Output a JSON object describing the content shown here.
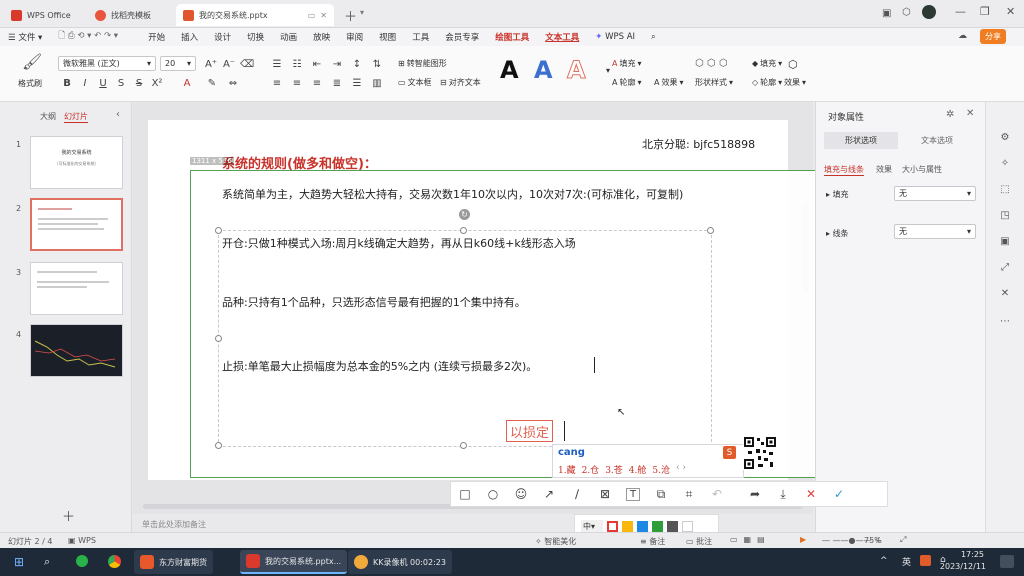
{
  "tabs": {
    "t1": "WPS Office",
    "t2": "找稻壳模板",
    "t3": "我的交易系统.pptx"
  },
  "menu": {
    "file": "文件",
    "items": [
      "开始",
      "插入",
      "设计",
      "切换",
      "动画",
      "放映",
      "审阅",
      "视图",
      "工具",
      "会员专享"
    ],
    "drawing_tools": "绘图工具",
    "text_tools": "文本工具",
    "wps_ai": "WPS AI",
    "share": "分享"
  },
  "ribbon": {
    "format_painter": "格式刷",
    "font_name": "微软雅黑 (正文)",
    "font_size": "20",
    "convert_shape": "转智能图形",
    "text_box": "文本框",
    "align_text": "对齐文本",
    "fill": "填充",
    "outline": "轮廓",
    "effect": "效果",
    "shape_style": "形状样式",
    "big_a": "A"
  },
  "left_pane": {
    "tab_outline": "大纲",
    "tab_slides": "幻灯片",
    "thumb1_title": "我的交易系统",
    "thumb1_sub": "（可标准化的交易系统）"
  },
  "slide": {
    "size_label": "1311 x 576",
    "contact": "北京分聪: bjfc518898",
    "heading": "系统的规则(做多和做空)：",
    "line1": "系统简单为主，大趋势大轻松大持有，交易次数1年10次以内，10次对7次:(可标准化，可复制)",
    "line2": "开仓:只做1种模式入场:周月k线确定大趋势，再从日k60线+k线形态入场",
    "line3": "品种:只持有1个品种，只选形态信号最有把握的1个集中持有。",
    "line4": "止损:单笔最大止损幅度为总本金的5%之内 (连续亏损最多2次)。",
    "typed_text": "以损定"
  },
  "ime": {
    "pinyin": "cang",
    "candidates": [
      "1.藏",
      "2.仓",
      "3.苍",
      "4.舱",
      "5.沧"
    ]
  },
  "right_pane": {
    "title": "对象属性",
    "tab1": "形状选项",
    "tab2": "文本选项",
    "sub1": "填充与线条",
    "sub2": "效果",
    "sub3": "大小与属性",
    "fill_label": "填充",
    "fill_value": "无",
    "line_label": "线条",
    "line_value": "无"
  },
  "colorbar": {
    "size_label": "中",
    "colors": [
      "#e53935",
      "#f9b90c",
      "#1e88e5",
      "#2e9e3a",
      "#555555",
      "#ffffff"
    ]
  },
  "status": {
    "slide_count": "幻灯片 2 / 4",
    "wps": "WPS",
    "notes_placeholder": "单击此处添加备注",
    "beautify": "智能美化",
    "notes": "备注",
    "comment": "批注",
    "zoom": "75%"
  },
  "taskbar": {
    "app1": "东方财富期货",
    "app2": "我的交易系统.pptx...",
    "app3": "KK录像机 00:02:23",
    "time": "17:25",
    "date": "2023/12/11",
    "ime_short": "英"
  }
}
